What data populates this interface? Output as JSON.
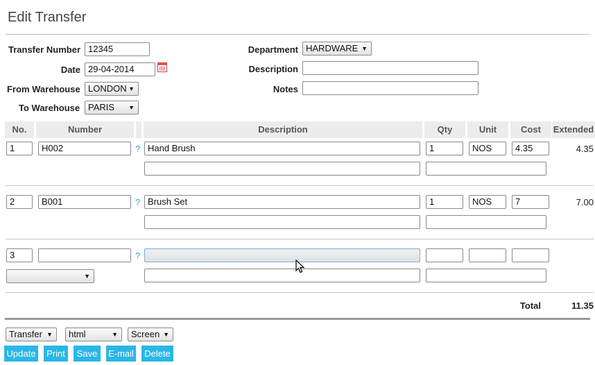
{
  "page": {
    "title": "Edit Transfer"
  },
  "form": {
    "transfer_number": {
      "label": "Transfer Number",
      "value": "12345"
    },
    "date": {
      "label": "Date",
      "value": "29-04-2014"
    },
    "from_warehouse": {
      "label": "From Warehouse",
      "value": "LONDON"
    },
    "to_warehouse": {
      "label": "To Warehouse",
      "value": "PARIS"
    },
    "department": {
      "label": "Department",
      "value": "HARDWARE"
    },
    "description": {
      "label": "Description",
      "value": ""
    },
    "notes": {
      "label": "Notes",
      "value": ""
    }
  },
  "table": {
    "columns": {
      "no": "No.",
      "number": "Number",
      "description": "Description",
      "qty": "Qty",
      "unit": "Unit",
      "cost": "Cost",
      "extended": "Extended"
    },
    "rows": [
      {
        "no": "1",
        "number": "H002",
        "help": "?",
        "description": "Hand Brush",
        "qty": "1",
        "unit": "NOS",
        "cost": "4.35",
        "extended": "4.35"
      },
      {
        "no": "2",
        "number": "B001",
        "help": "?",
        "description": "Brush Set",
        "qty": "1",
        "unit": "NOS",
        "cost": "7",
        "extended": "7.00"
      },
      {
        "no": "3",
        "number": "",
        "help": "?",
        "description": "",
        "qty": "",
        "unit": "",
        "cost": "",
        "extended": ""
      }
    ],
    "total_label": "Total",
    "total_value": "11.35"
  },
  "footer": {
    "doc_type": "Transfer",
    "format": "html",
    "output": "Screen",
    "buttons": {
      "update": "Update",
      "print": "Print",
      "save": "Save",
      "email": "E-mail",
      "delete": "Delete"
    }
  },
  "icons": {
    "calendar": "calendar-icon",
    "dropdown": "chevron-down-icon",
    "cursor": "mouse-pointer-icon"
  },
  "colors": {
    "button": "#2bb6e6",
    "help_link": "#2ea8d6",
    "focus_border": "#7aaedc"
  }
}
